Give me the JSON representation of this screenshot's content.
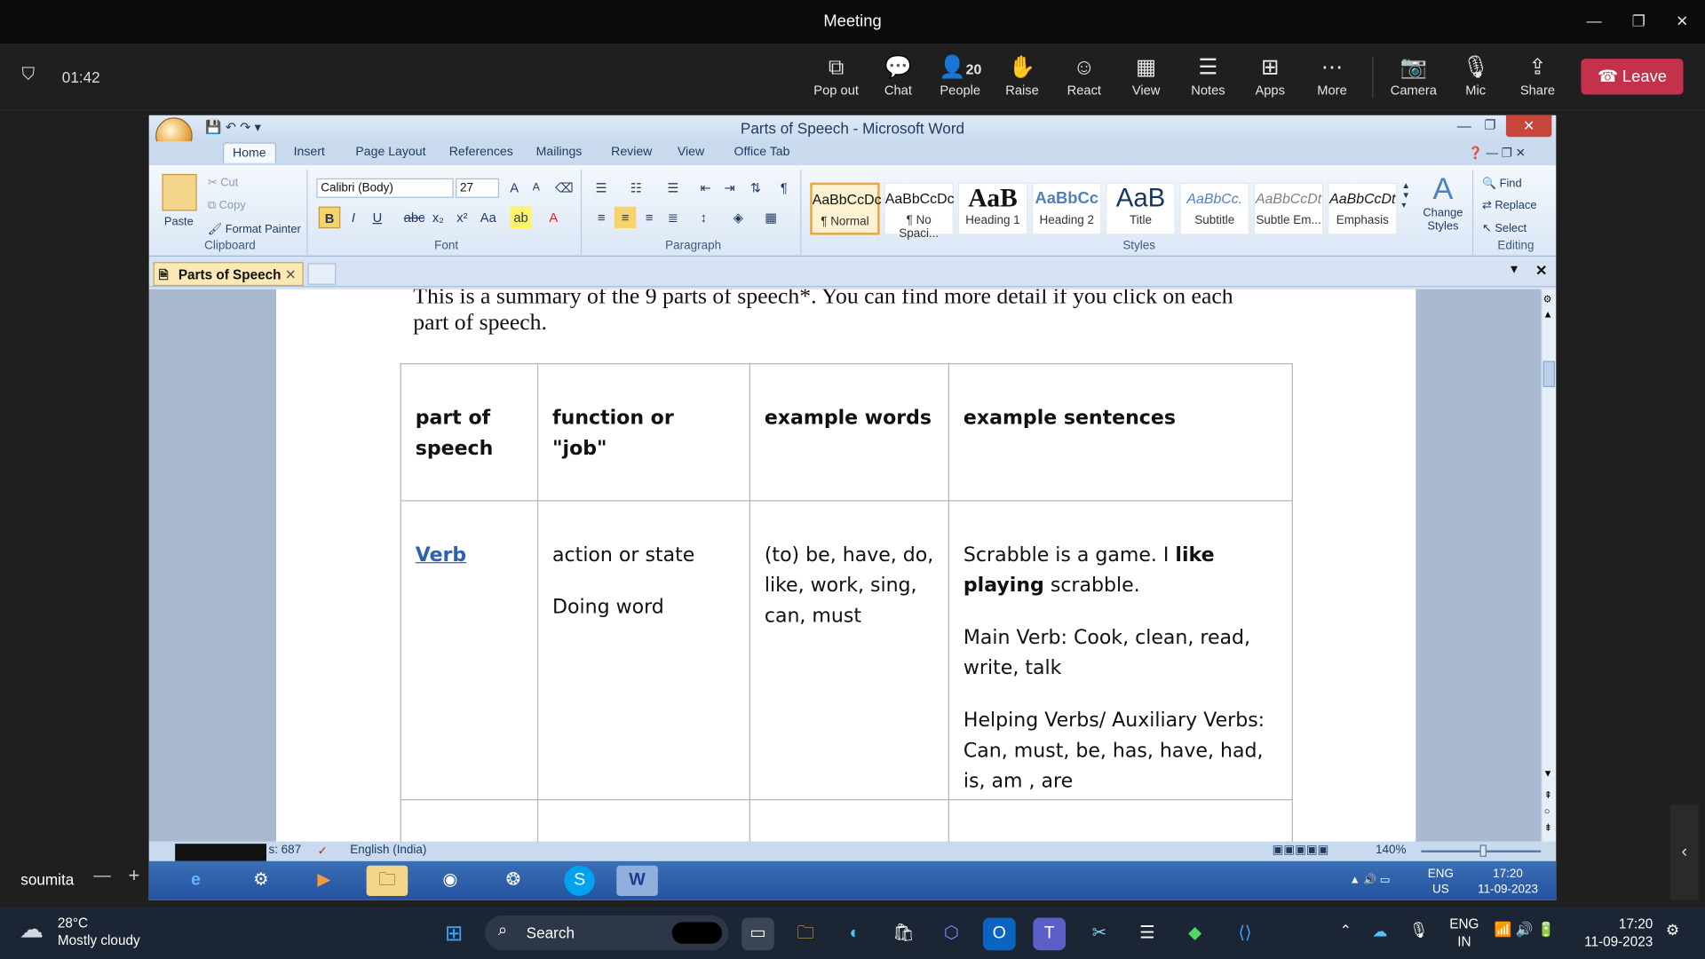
{
  "window": {
    "title": "Meeting"
  },
  "toolbar": {
    "timer": "01:42",
    "buttons": [
      {
        "label": "Pop out",
        "icon": "pop-out-icon"
      },
      {
        "label": "Chat",
        "icon": "chat-icon"
      },
      {
        "label": "People",
        "icon": "people-icon",
        "count": "20"
      },
      {
        "label": "Raise",
        "icon": "raise-hand-icon"
      },
      {
        "label": "React",
        "icon": "smile-icon"
      },
      {
        "label": "View",
        "icon": "grid-icon"
      },
      {
        "label": "Notes",
        "icon": "notes-icon"
      },
      {
        "label": "Apps",
        "icon": "apps-icon"
      },
      {
        "label": "More",
        "icon": "more-icon"
      },
      {
        "label": "Camera",
        "icon": "camera-off-icon"
      },
      {
        "label": "Mic",
        "icon": "mic-off-icon"
      },
      {
        "label": "Share",
        "icon": "share-icon"
      }
    ],
    "leave_label": "Leave",
    "leave_color": "#c4314b"
  },
  "word": {
    "title": "Parts of Speech - Microsoft Word",
    "tabs": [
      "Home",
      "Insert",
      "Page Layout",
      "References",
      "Mailings",
      "Review",
      "View",
      "Office Tab"
    ],
    "clipboard": {
      "paste": "Paste",
      "cut": "Cut",
      "copy": "Copy",
      "format_painter": "Format Painter",
      "label": "Clipboard"
    },
    "font": {
      "name": "Calibri (Body)",
      "size": "27",
      "label": "Font"
    },
    "paragraph": {
      "label": "Paragraph"
    },
    "styles": {
      "label": "Styles",
      "items": [
        {
          "preview": "AaBbCcDc",
          "name": "¶ Normal"
        },
        {
          "preview": "AaBbCcDc",
          "name": "¶ No Spaci..."
        },
        {
          "preview": "AaB",
          "name": "Heading 1"
        },
        {
          "preview": "AaBbCc",
          "name": "Heading 2"
        },
        {
          "preview": "AaB",
          "name": "Title"
        },
        {
          "preview": "AaBbCc.",
          "name": "Subtitle"
        },
        {
          "preview": "AaBbCcDt",
          "name": "Subtle Em..."
        },
        {
          "preview": "AaBbCcDt",
          "name": "Emphasis"
        }
      ],
      "change": "Change Styles"
    },
    "editing": {
      "find": "Find",
      "replace": "Replace",
      "select": "Select",
      "label": "Editing"
    },
    "doc_tab": "Parts of Speech",
    "intro_line1": "This is a summary of the 9 parts of speech*. You can find more detail if you click on each",
    "intro_line2": "part of speech.",
    "table": {
      "headers": [
        "part of speech",
        "function or \"job\"",
        "example words",
        "example sentences"
      ],
      "verb": {
        "pos": "Verb",
        "function1": "action or state",
        "function2": "Doing word",
        "examples": "(to) be, have, do, like, work, sing, can, must",
        "s1a": "Scrabble is a game. I ",
        "s1b": "like playing",
        "s1c": " scrabble.",
        "s2": "Main Verb: Cook, clean, read, write, talk",
        "s3": "Helping Verbs/ Auxiliary Verbs: Can, must, be, has, have, had, is, am , are"
      }
    },
    "status": {
      "words": "s: 687",
      "language": "English (India)",
      "zoom": "140%"
    },
    "taskbar": {
      "lang1": "ENG",
      "lang2": "US",
      "time": "17:20",
      "date": "11-09-2023"
    }
  },
  "participant": {
    "name": "soumita"
  },
  "win_taskbar": {
    "weather_temp": "28°C",
    "weather_desc": "Mostly cloudy",
    "search": "Search",
    "lang1": "ENG",
    "lang2": "IN",
    "time": "17:20",
    "date": "11-09-2023"
  }
}
